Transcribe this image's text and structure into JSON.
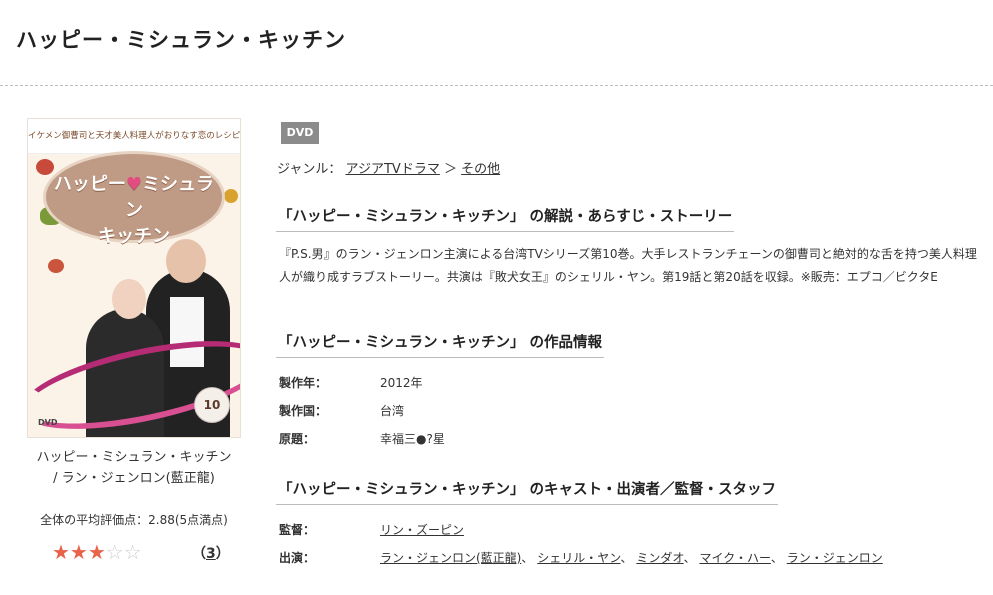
{
  "page": {
    "title": "ハッピー・ミシュラン・キッチン"
  },
  "cover": {
    "top_text": "イケメン御曹司と天才美人料理人がおりなす恋のレシピ！",
    "title_line1": "ハッピー",
    "title_heart": "♥",
    "title_line1b": "ミシュラン",
    "title_line2": "キッチン",
    "vol": "10",
    "dvd_mark": "DVD"
  },
  "caption": {
    "line1": "ハッピー・ミシュラン・キッチン",
    "line2": "/ ラン・ジェンロン(藍正龍)"
  },
  "rating": {
    "text": "全体の平均評価点：2.88(5点満点)",
    "stars_on": "★★★",
    "stars_off": "☆☆",
    "score": 2.88,
    "count_open": "（",
    "count": "3",
    "count_close": "）",
    "star_color": "#e8634a"
  },
  "product": {
    "format_badge": "DVD",
    "genre_label": "ジャンル：",
    "genre_primary": "アジアTVドラマ",
    "genre_separator": "＞",
    "genre_secondary": "その他"
  },
  "sections": {
    "story_heading": "「ハッピー・ミシュラン・キッチン」 の解説・あらすじ・ストーリー",
    "story_text": "『P.S.男』のラン・ジェンロン主演による台湾TVシリーズ第10巻。大手レストランチェーンの御曹司と絶対的な舌を持つ美人料理人が織り成すラブストーリー。共演は『敗犬女王』のシェリル・ヤン。第19話と第20話を収録。※販売：エプコ／ビクタE",
    "info_heading": "「ハッピー・ミシュラン・キッチン」 の作品情報",
    "cast_heading": "「ハッピー・ミシュラン・キッチン」 のキャスト・出演者／監督・スタッフ"
  },
  "info": {
    "year_label": "製作年：",
    "year_value": "2012年",
    "country_label": "製作国：",
    "country_value": "台湾",
    "original_label": "原題：",
    "original_value": "幸福三●?星"
  },
  "cast": {
    "director_label": "監督：",
    "director": "リン・ズーピン",
    "cast_label": "出演：",
    "members": [
      "ラン・ジェンロン(藍正龍)",
      "シェリル・ヤン",
      "ミンダオ",
      "マイク・ハー",
      "ラン・ジェンロン"
    ],
    "separator": "、"
  }
}
